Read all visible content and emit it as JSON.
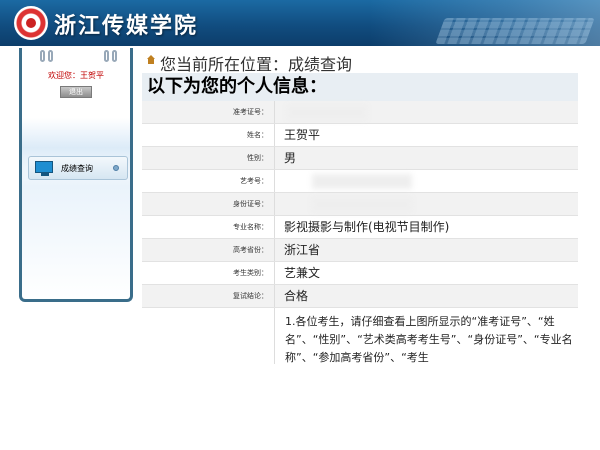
{
  "header": {
    "site_name": "浙江传媒学院"
  },
  "sidebar": {
    "welcome": "欢迎您：王贺平",
    "logout_label": "退出",
    "menu": [
      {
        "label": "成绩查询"
      }
    ]
  },
  "location": {
    "text": "您当前所在位置：成绩查询"
  },
  "info": {
    "title": "以下为您的个人信息：",
    "rows": [
      {
        "label": "准考证号：",
        "value": ""
      },
      {
        "label": "姓名：",
        "value": "王贺平"
      },
      {
        "label": "性别：",
        "value": "男"
      },
      {
        "label": "艺考号：",
        "value": ""
      },
      {
        "label": "身份证号：",
        "value": ""
      },
      {
        "label": "专业名称：",
        "value": "影视摄影与制作(电视节目制作)"
      },
      {
        "label": "高考省份：",
        "value": "浙江省"
      },
      {
        "label": "考生类别：",
        "value": "艺兼文"
      },
      {
        "label": "复试结论：",
        "value": "合格"
      }
    ],
    "note": "1.各位考生，请仔细查看上图所显示的“准考证号”、“姓名”、“性别”、“艺术类高考考生号”、“身份证号”、“专业名称”、“参加高考省份”、“考生"
  },
  "colors": {
    "header_blue": "#114d80",
    "sidebar_border": "#3a6d8a",
    "welcome_red": "#c00000"
  }
}
